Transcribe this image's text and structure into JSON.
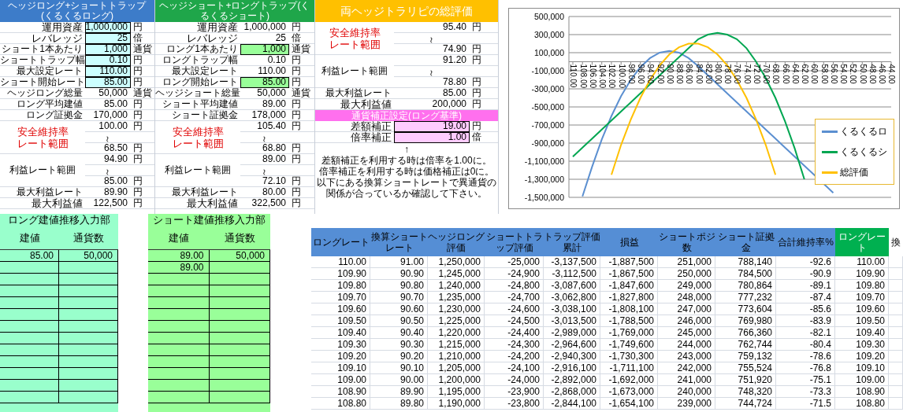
{
  "panels": [
    {
      "title": "ヘッジロング+ショートトラップ(くるくるロング)",
      "color": "#3d7cc9",
      "items": [
        {
          "kind": "field",
          "label": "運用資産",
          "value": "1,000,000",
          "unit": "円",
          "editable": true
        },
        {
          "kind": "field",
          "label": "レバレッジ",
          "value": "25",
          "unit": "倍",
          "editable": true
        },
        {
          "kind": "field",
          "label": "ショート1本あたり",
          "value": "1,000",
          "unit": "通貨",
          "editable": true
        },
        {
          "kind": "field",
          "label": "ショートトラップ幅",
          "value": "0.10",
          "unit": "円",
          "editable": true
        },
        {
          "kind": "field",
          "label": "最大設定レート",
          "value": "110.00",
          "unit": "円",
          "editable": true
        },
        {
          "kind": "field",
          "label": "ショート開始レート",
          "value": "85.00",
          "unit": "円",
          "editable": true
        },
        {
          "kind": "field",
          "label": "ヘッジロング総量",
          "value": "50,000",
          "unit": "通貨",
          "editable": false
        },
        {
          "kind": "field",
          "label": "ロング平均建値",
          "value": "85.00",
          "unit": "円",
          "editable": false
        },
        {
          "kind": "field",
          "label": "ロング証拠金",
          "value": "170,000",
          "unit": "円",
          "editable": false
        },
        {
          "kind": "range",
          "label": "安全維持率レート範囲",
          "warning": true,
          "upper": "100.00",
          "upper_unit": "円",
          "separator": "～",
          "lower": "68.50",
          "lower_unit": "円"
        },
        {
          "kind": "range",
          "label": "利益レート範囲",
          "warning": false,
          "upper": "94.90",
          "upper_unit": "円",
          "separator": "～",
          "lower": "85.00",
          "lower_unit": "円"
        },
        {
          "kind": "field",
          "label": "最大利益レート",
          "value": "89.90",
          "unit": "円",
          "editable": false
        },
        {
          "kind": "field",
          "label": "最大利益値",
          "value": "122,500",
          "unit": "円",
          "editable": false
        }
      ]
    },
    {
      "title": "ヘッジショート+ロングトラップ(くるくるショート)",
      "color": "#1fa64a",
      "items": [
        {
          "kind": "field",
          "label": "運用資産",
          "value": "1,000,000",
          "unit": "円",
          "editable": false
        },
        {
          "kind": "field",
          "label": "レバレッジ",
          "value": "25",
          "unit": "倍",
          "editable": false
        },
        {
          "kind": "field",
          "label": "ロング1本あたり",
          "value": "1,000",
          "unit": "通貨",
          "editable": true
        },
        {
          "kind": "field",
          "label": "ロングトラップ幅",
          "value": "0.10",
          "unit": "円",
          "editable": false
        },
        {
          "kind": "field",
          "label": "最大設定レート",
          "value": "110.00",
          "unit": "円",
          "editable": false
        },
        {
          "kind": "field",
          "label": "ロング開始レート",
          "value": "85.00",
          "unit": "円",
          "editable": true
        },
        {
          "kind": "field",
          "label": "ヘッジショート総量",
          "value": "50,000",
          "unit": "通貨",
          "editable": false
        },
        {
          "kind": "field",
          "label": "ショート平均建値",
          "value": "89.00",
          "unit": "円",
          "editable": false
        },
        {
          "kind": "field",
          "label": "ショート証拠金",
          "value": "178,000",
          "unit": "円",
          "editable": false
        },
        {
          "kind": "range",
          "label": "安全維持率レート範囲",
          "warning": true,
          "upper": "105.40",
          "upper_unit": "円",
          "separator": "～",
          "lower": "68.80",
          "lower_unit": "円"
        },
        {
          "kind": "range",
          "label": "利益レート範囲",
          "warning": false,
          "upper": "89.00",
          "upper_unit": "円",
          "separator": "～",
          "lower": "72.10",
          "lower_unit": "円"
        },
        {
          "kind": "field",
          "label": "最大利益レート",
          "value": "80.00",
          "unit": "円",
          "editable": false
        },
        {
          "kind": "field",
          "label": "最大利益値",
          "value": "322,500",
          "unit": "円",
          "editable": false
        }
      ]
    },
    {
      "title": "両ヘッジトラリピの総評価",
      "color": "#ffc000",
      "items": [
        {
          "kind": "range",
          "label": "安全維持率レート範囲",
          "warning": true,
          "upper": "95.40",
          "upper_unit": "円",
          "separator": "～",
          "lower": "74.90",
          "lower_unit": "円"
        },
        {
          "kind": "range",
          "label": "利益レート範囲",
          "warning": false,
          "upper": "91.20",
          "upper_unit": "円",
          "separator": "～",
          "lower": "78.80",
          "lower_unit": "円"
        },
        {
          "kind": "field",
          "label": "最大利益レート",
          "value": "85.00",
          "unit": "円",
          "editable": false
        },
        {
          "kind": "field",
          "label": "最大利益値",
          "value": "200,000",
          "unit": "円",
          "editable": false
        },
        {
          "kind": "section",
          "title": "通貨補正設定(ロング基準)"
        },
        {
          "kind": "field",
          "label": "差額補正",
          "value": "19.00",
          "unit": "円",
          "editable": true
        },
        {
          "kind": "field",
          "label": "倍率補正",
          "value": "1.00",
          "unit": "倍",
          "editable": true
        },
        {
          "kind": "note",
          "arrow": "↑",
          "lines": [
            "差額補正を利用する時は倍率を1.00に。",
            "倍率補正を利用する時は価格補正は0に。",
            "以下にある換算ショートレートで異通貨の",
            "関係が合っているか確認して下さい。"
          ]
        }
      ]
    }
  ],
  "chart": {
    "chart_data": {
      "type": "line",
      "categories": [
        "110.00",
        "108.00",
        "106.00",
        "104.00",
        "102.00",
        "100.00",
        "98.00",
        "96.00",
        "94.00",
        "92.00",
        "90.00",
        "88.00",
        "86.00",
        "84.00",
        "82.00",
        "80.00",
        "78.00",
        "76.00",
        "74.00",
        "72.00",
        "70.00",
        "68.00",
        "66.00",
        "64.00",
        "62.00",
        "60.00",
        "58.00",
        "56.00",
        "54.00",
        "52.00",
        "50.00",
        "48.00",
        "46.00",
        "44.00"
      ],
      "ylim": [
        -1500000,
        500000
      ],
      "grid": true,
      "legend": "right",
      "yticks": [
        {
          "value": 500000,
          "label": "500,000"
        },
        {
          "value": 300000,
          "label": "300,000"
        },
        {
          "value": 100000,
          "label": "100,000"
        },
        {
          "value": -100000,
          "label": "-100,000"
        },
        {
          "value": -300000,
          "label": "-300,000"
        },
        {
          "value": -500000,
          "label": "-500,000"
        },
        {
          "value": -700000,
          "label": "-700,000"
        },
        {
          "value": -900000,
          "label": "-900,000"
        },
        {
          "value": -1100000,
          "label": "-1,100,000"
        },
        {
          "value": -1300000,
          "label": "-1,300,000"
        },
        {
          "value": -1500000,
          "label": "-1,500,000"
        }
      ],
      "series": [
        {
          "name": "くるくるロ",
          "color": "#5b8fd0",
          "values": [
            null,
            -1490000,
            -1160000,
            -860000,
            -600000,
            -380000,
            -200000,
            -60000,
            40000,
            100000,
            120000,
            100000,
            40000,
            -50000,
            -150000,
            -250000,
            -350000,
            -450000,
            -550000,
            -650000,
            -750000,
            -850000,
            -950000,
            -1050000,
            -1150000,
            -1250000,
            -1350000,
            -1450000,
            null,
            null,
            null,
            null,
            null,
            null
          ]
        },
        {
          "name": "くるくるシ",
          "color": "#00a651",
          "values": [
            -1050000,
            -950000,
            -850000,
            -750000,
            -650000,
            -550000,
            -450000,
            -350000,
            -250000,
            -150000,
            -50000,
            50000,
            150000,
            250000,
            300000,
            320000,
            300000,
            250000,
            150000,
            0,
            -180000,
            -400000,
            -660000,
            -960000,
            -1300000,
            null,
            null,
            null,
            null,
            null,
            null,
            null,
            null,
            null
          ]
        },
        {
          "name": "総評価",
          "color": "#ffc000",
          "values": [
            null,
            null,
            null,
            null,
            -1250000,
            -920000,
            -640000,
            -400000,
            -200000,
            -40000,
            80000,
            160000,
            200000,
            200000,
            160000,
            80000,
            -40000,
            -200000,
            -400000,
            -640000,
            -920000,
            -1250000,
            null,
            null,
            null,
            null,
            null,
            null,
            null,
            null,
            null,
            null,
            null,
            null
          ]
        }
      ]
    }
  },
  "input_sections": [
    {
      "title": "ロング建値推移入力部",
      "color": "#99ffcc",
      "headers": [
        "建値",
        "通貨数"
      ],
      "rows": [
        {
          "price": "85.00",
          "quantity": "50,000"
        }
      ]
    },
    {
      "title": "ショート建値推移入力部",
      "color": "#99ff99",
      "headers": [
        "建値",
        "通貨数"
      ],
      "rows": [
        {
          "price": "89.00",
          "quantity": "50,000"
        },
        {
          "price": "89.00"
        }
      ]
    }
  ],
  "table": {
    "columns": [
      {
        "label": "ロングレート",
        "color": "#558ed5"
      },
      {
        "label": "換算ショートレート",
        "color": "#558ed5"
      },
      {
        "label": "ヘッジロング評価",
        "color": "#558ed5"
      },
      {
        "label": "ショートトラップ評価",
        "color": "#558ed5"
      },
      {
        "label": "トラップ評価累計",
        "color": "#558ed5"
      },
      {
        "label": "損益",
        "color": "#558ed5"
      },
      {
        "label": "ショートポジ数",
        "color": "#558ed5"
      },
      {
        "label": "ショート証拠金",
        "color": "#558ed5"
      },
      {
        "label": "合計維持率%",
        "color": "#558ed5"
      },
      {
        "label": "ロングレート",
        "color": "#00b050"
      },
      {
        "label": "換",
        "color": "#ffffff"
      }
    ],
    "rows": [
      [
        "110.00",
        "91.00",
        "1,250,000",
        "-25,000",
        "-3,137,500",
        "-1,887,500",
        "251,000",
        "788,140",
        "-92.6",
        "110.00"
      ],
      [
        "109.90",
        "90.90",
        "1,245,000",
        "-24,900",
        "-3,112,500",
        "-1,867,500",
        "250,000",
        "784,500",
        "-90.9",
        "109.90"
      ],
      [
        "109.80",
        "90.80",
        "1,240,000",
        "-24,800",
        "-3,087,600",
        "-1,847,600",
        "249,000",
        "780,864",
        "-89.1",
        "109.80"
      ],
      [
        "109.70",
        "90.70",
        "1,235,000",
        "-24,700",
        "-3,062,800",
        "-1,827,800",
        "248,000",
        "777,232",
        "-87.4",
        "109.70"
      ],
      [
        "109.60",
        "90.60",
        "1,230,000",
        "-24,600",
        "-3,038,100",
        "-1,808,100",
        "247,000",
        "773,604",
        "-85.6",
        "109.60"
      ],
      [
        "109.50",
        "90.50",
        "1,225,000",
        "-24,500",
        "-3,013,500",
        "-1,788,500",
        "246,000",
        "769,980",
        "-83.9",
        "109.50"
      ],
      [
        "109.40",
        "90.40",
        "1,220,000",
        "-24,400",
        "-2,989,000",
        "-1,769,000",
        "245,000",
        "766,360",
        "-82.1",
        "109.40"
      ],
      [
        "109.30",
        "90.30",
        "1,215,000",
        "-24,300",
        "-2,964,600",
        "-1,749,600",
        "244,000",
        "762,744",
        "-80.4",
        "109.30"
      ],
      [
        "109.20",
        "90.20",
        "1,210,000",
        "-24,200",
        "-2,940,300",
        "-1,730,300",
        "243,000",
        "759,132",
        "-78.6",
        "109.20"
      ],
      [
        "109.10",
        "90.10",
        "1,205,000",
        "-24,100",
        "-2,916,100",
        "-1,711,100",
        "242,000",
        "755,524",
        "-76.8",
        "109.10"
      ],
      [
        "109.00",
        "90.00",
        "1,200,000",
        "-24,000",
        "-2,892,000",
        "-1,692,000",
        "241,000",
        "751,920",
        "-75.1",
        "109.00"
      ],
      [
        "108.90",
        "89.90",
        "1,195,000",
        "-23,900",
        "-2,868,000",
        "-1,673,000",
        "240,000",
        "748,320",
        "-73.3",
        "108.90"
      ],
      [
        "108.80",
        "89.80",
        "1,190,000",
        "-23,800",
        "-2,844,100",
        "-1,654,100",
        "239,000",
        "744,724",
        "-71.5",
        "108.80"
      ]
    ]
  }
}
